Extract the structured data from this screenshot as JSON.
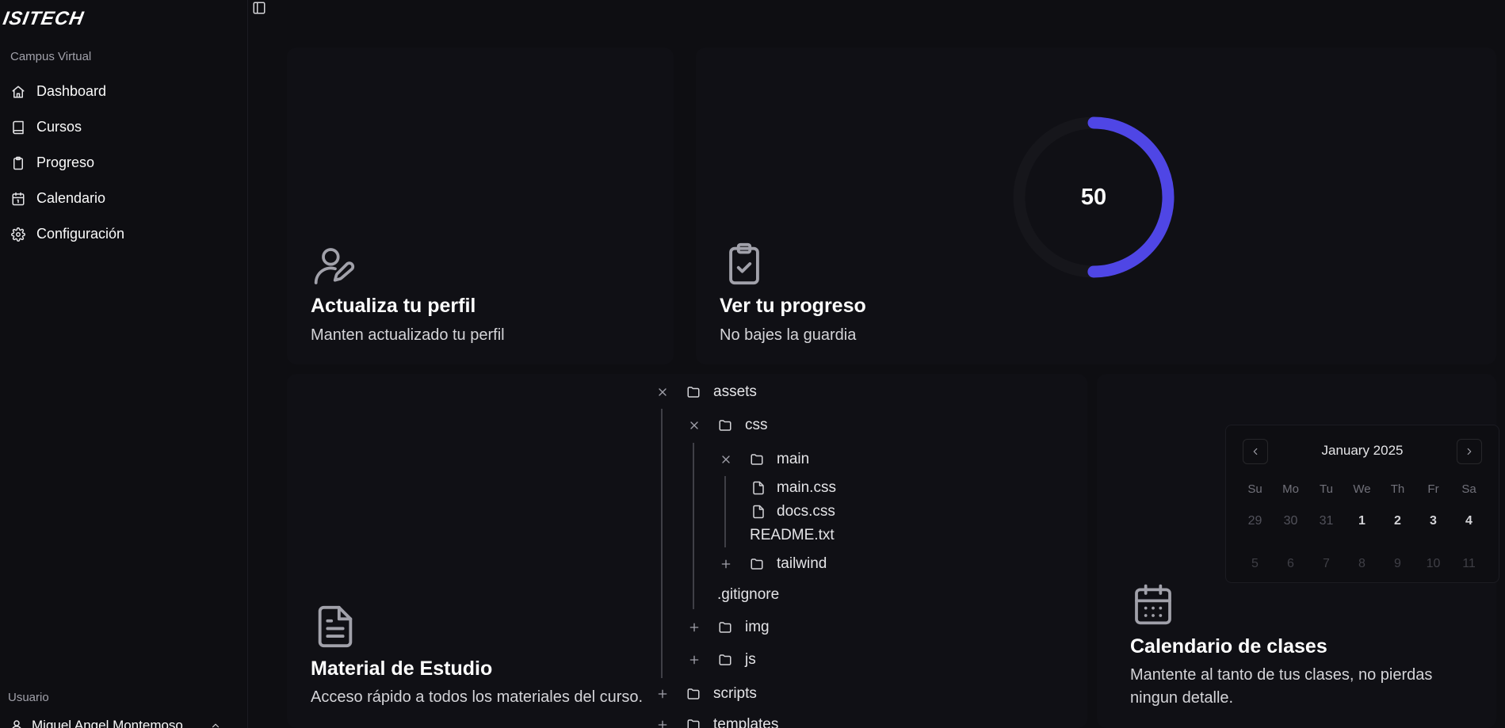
{
  "app": {
    "logo_text": "ISITECH"
  },
  "sidebar": {
    "section_label": "Campus Virtual",
    "items": [
      {
        "label": "Dashboard",
        "icon": "home-icon"
      },
      {
        "label": "Cursos",
        "icon": "book-icon"
      },
      {
        "label": "Progreso",
        "icon": "clipboard-icon"
      },
      {
        "label": "Calendario",
        "icon": "calendar-icon"
      },
      {
        "label": "Configuración",
        "icon": "gear-icon"
      }
    ],
    "user_section_label": "Usuario",
    "user_name": "Miguel Angel Montemoso"
  },
  "cards": {
    "profile": {
      "title": "Actualiza tu perfil",
      "desc": "Manten actualizado tu perfil"
    },
    "progress": {
      "title": "Ver tu progreso",
      "desc": "No bajes la guardia",
      "value": "50",
      "fraction": 0.5
    },
    "material": {
      "title": "Material de Estudio",
      "desc": "Acceso rápido a todos los materiales del curso."
    },
    "calendar": {
      "title": "Calendario de clases",
      "desc": "Mantente al tanto de tus clases, no pierdas ningun detalle."
    }
  },
  "file_tree": {
    "items": [
      {
        "name": "assets",
        "type": "folder",
        "state": "open"
      },
      {
        "name": "css",
        "type": "folder",
        "state": "open"
      },
      {
        "name": "main",
        "type": "folder",
        "state": "open"
      },
      {
        "name": "main.css",
        "type": "file"
      },
      {
        "name": "docs.css",
        "type": "file"
      },
      {
        "name": "README.txt",
        "type": "text"
      },
      {
        "name": "tailwind",
        "type": "folder",
        "state": "closed"
      },
      {
        "name": ".gitignore",
        "type": "text"
      },
      {
        "name": "img",
        "type": "folder",
        "state": "closed"
      },
      {
        "name": "js",
        "type": "folder",
        "state": "closed"
      },
      {
        "name": "scripts",
        "type": "folder",
        "state": "closed"
      },
      {
        "name": "templates",
        "type": "folder",
        "state": "closed"
      }
    ]
  },
  "calendar": {
    "month_label": "January 2025",
    "weekdays": [
      "Su",
      "Mo",
      "Tu",
      "We",
      "Th",
      "Fr",
      "Sa"
    ],
    "weeks": [
      [
        "29",
        "30",
        "31",
        "1",
        "2",
        "3",
        "4"
      ],
      [
        "5",
        "6",
        "7",
        "8",
        "9",
        "10",
        "11"
      ]
    ]
  },
  "colors": {
    "background": "#0e0e12",
    "accent": "#4f46e5",
    "text": "#f4f4f5"
  }
}
